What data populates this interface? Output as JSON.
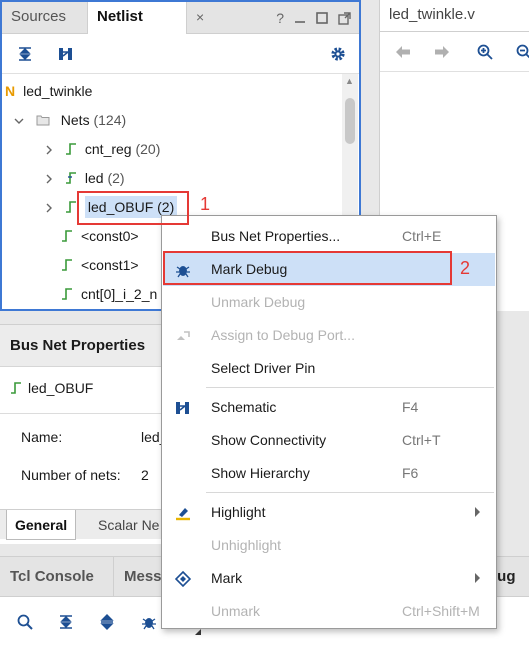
{
  "netlist_panel": {
    "tabs": [
      "Sources",
      "Netlist"
    ],
    "close_glyph": "×",
    "header_icons": [
      "?",
      "minimize-icon",
      "maximize-icon",
      "float-icon"
    ],
    "toolbar": [
      "collapse-all-icon",
      "schematic-icon",
      "settings-icon"
    ],
    "tree": {
      "root": "led_twinkle",
      "nets_label": "Nets",
      "nets_count": "(124)",
      "items": [
        {
          "name": "cnt_reg",
          "count": "(20)"
        },
        {
          "name": "led",
          "count": "(2)"
        },
        {
          "name": "led_OBUF",
          "count": "(2)"
        },
        {
          "name": "<const0>",
          "count": ""
        },
        {
          "name": "<const1>",
          "count": ""
        },
        {
          "name": "cnt[0]_i_2_n",
          "count": ""
        }
      ]
    }
  },
  "editor_panel": {
    "tab": "led_twinkle.v",
    "toolbar": [
      "back-icon",
      "forward-icon",
      "zoom-in-icon",
      "zoom-out-icon"
    ]
  },
  "props_panel": {
    "title": "Bus Net Properties",
    "net_name": "led_OBUF",
    "fields": [
      {
        "label": "Name:",
        "value": "led_"
      },
      {
        "label": "Number of nets:",
        "value": "2"
      }
    ],
    "tabs": [
      "General",
      "Scalar Ne"
    ]
  },
  "console_panel": {
    "tabs": [
      "Tcl Console",
      "Mess"
    ],
    "right_fragment": "bug",
    "toolbar": [
      "search-icon",
      "collapse-icon",
      "expand-icon",
      "bug-icon"
    ]
  },
  "context_menu": {
    "items": [
      {
        "label": "Bus Net Properties...",
        "shortcut": "Ctrl+E",
        "enabled": true,
        "icon": ""
      },
      {
        "label": "Mark Debug",
        "shortcut": "",
        "enabled": true,
        "icon": "bug-icon",
        "highlighted": true
      },
      {
        "label": "Unmark Debug",
        "shortcut": "",
        "enabled": false,
        "icon": ""
      },
      {
        "label": "Assign to Debug Port...",
        "shortcut": "",
        "enabled": false,
        "icon": "assign-icon"
      },
      {
        "label": "Select Driver Pin",
        "shortcut": "",
        "enabled": true,
        "icon": ""
      },
      {
        "label": "Schematic",
        "shortcut": "F4",
        "enabled": true,
        "icon": "schematic-icon"
      },
      {
        "label": "Show Connectivity",
        "shortcut": "Ctrl+T",
        "enabled": true,
        "icon": ""
      },
      {
        "label": "Show Hierarchy",
        "shortcut": "F6",
        "enabled": true,
        "icon": ""
      },
      {
        "label": "Highlight",
        "shortcut": "",
        "enabled": true,
        "icon": "highlight-icon",
        "submenu": true
      },
      {
        "label": "Unhighlight",
        "shortcut": "",
        "enabled": false,
        "icon": ""
      },
      {
        "label": "Mark",
        "shortcut": "",
        "enabled": true,
        "icon": "mark-icon",
        "submenu": true
      },
      {
        "label": "Unmark",
        "shortcut": "Ctrl+Shift+M",
        "enabled": false,
        "icon": ""
      }
    ]
  },
  "annotations": {
    "step1": "1",
    "step2": "2",
    "color": "#e53935"
  },
  "colors": {
    "accent": "#3e78d4",
    "icon_blue": "#1d4f93",
    "net_green": "#3a9a3a",
    "highlight_bg": "#cde0f7",
    "selection_bg": "#cde0f7"
  }
}
